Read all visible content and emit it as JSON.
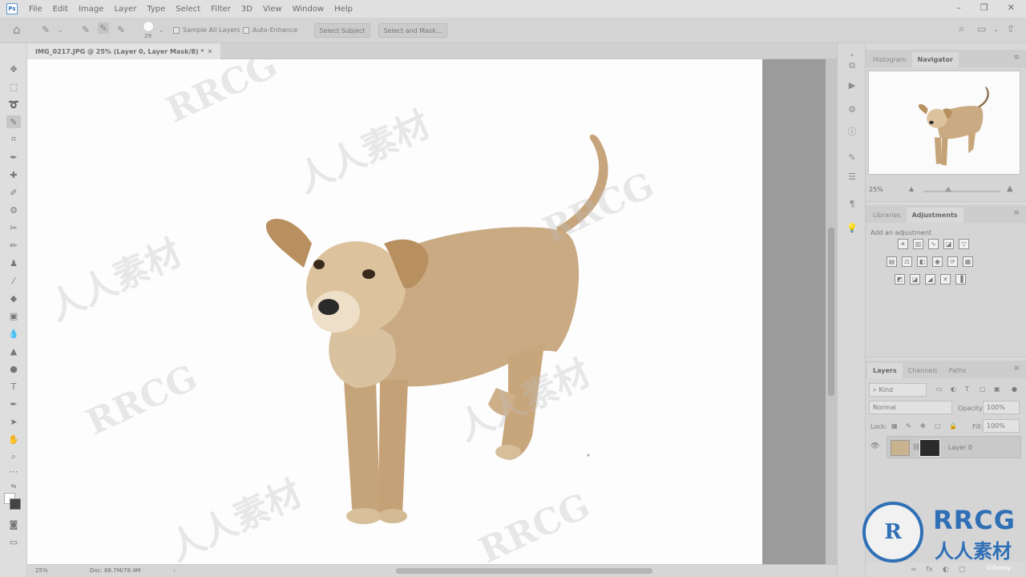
{
  "menubar": {
    "logo": "Ps",
    "items": [
      "File",
      "Edit",
      "Image",
      "Layer",
      "Type",
      "Select",
      "Filter",
      "3D",
      "View",
      "Window",
      "Help"
    ],
    "window_controls": [
      "–",
      "❐",
      "✕"
    ]
  },
  "options": {
    "brush_size": "29",
    "sample_all_layers": "Sample All Layers",
    "auto_enhance": "Auto-Enhance",
    "select_subject": "Select Subject",
    "select_and_mask": "Select and Mask..."
  },
  "document": {
    "tab_title": "IMG_0217.JPG @ 25% (Layer 0, Layer Mask/8) * ",
    "tab_close": "✕"
  },
  "status": {
    "zoom": "25%",
    "doc": "Doc: 68.7M/78.4M"
  },
  "navigator": {
    "tabs": [
      "Histogram",
      "Navigator"
    ],
    "zoom": "25%"
  },
  "adjustments": {
    "tabs": [
      "Libraries",
      "Adjustments"
    ],
    "title": "Add an adjustment"
  },
  "layers": {
    "tabs": [
      "Layers",
      "Channels",
      "Paths"
    ],
    "filter_kind": "Kind",
    "blend_mode": "Normal",
    "opacity_label": "Opacity:",
    "opacity": "100%",
    "lock_label": "Lock:",
    "fill_label": "Fill:",
    "fill": "100%",
    "layer_name": "Layer 0",
    "bottom_icons": [
      "fx",
      "◐",
      "▢",
      "▣",
      "+",
      "🗑"
    ]
  },
  "watermark": {
    "brand": "RRCG",
    "sub": "人人素材",
    "udemy": "Udemy"
  },
  "colors": {
    "accent": "#2f6fb6",
    "canvas_bg": "#fdfdfd"
  }
}
